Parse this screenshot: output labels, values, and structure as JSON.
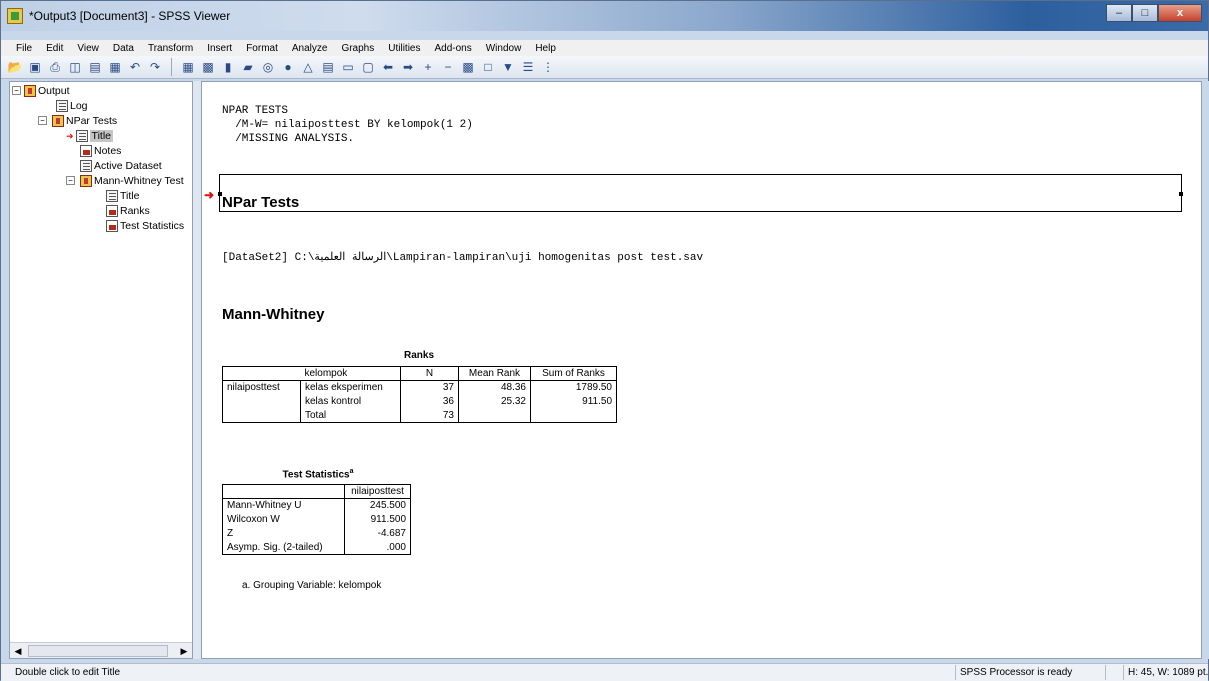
{
  "window": {
    "title": "*Output3 [Document3] - SPSS Viewer"
  },
  "menu": [
    "File",
    "Edit",
    "View",
    "Data",
    "Transform",
    "Insert",
    "Format",
    "Analyze",
    "Graphs",
    "Utilities",
    "Add-ons",
    "Window",
    "Help"
  ],
  "toolbar": {
    "icons": [
      "open-icon",
      "save-icon",
      "print-icon",
      "print-preview-icon",
      "export-icon",
      "dialog-recall-icon",
      "undo-icon",
      "redo-icon",
      "goto-data-icon",
      "goto-variable-icon",
      "variables-icon",
      "run-icon",
      "find-icon",
      "case-icon",
      "insert-output-icon",
      "insert-heading-icon",
      "insert-title-icon",
      "insert-text-icon",
      "back-icon",
      "forward-icon",
      "expand-icon",
      "collapse-icon",
      "show-icon",
      "hide-icon",
      "designate-window-icon",
      "select-last-output-icon",
      "pivot-icon"
    ]
  },
  "outline": {
    "nodes": [
      {
        "label": "Output"
      },
      {
        "label": "Log"
      },
      {
        "label": "NPar Tests"
      },
      {
        "label": "Title"
      },
      {
        "label": "Notes"
      },
      {
        "label": "Active Dataset"
      },
      {
        "label": "Mann-Whitney Test"
      },
      {
        "label": "Title"
      },
      {
        "label": "Ranks"
      },
      {
        "label": "Test Statistics"
      }
    ]
  },
  "content": {
    "syntax": "NPAR TESTS\n  /M-W= nilaiposttest BY kelompok(1 2)\n  /MISSING ANALYSIS.",
    "title_heading": "NPar Tests",
    "dataset_line": "[DataSet2] C:\\الرسالة العلمية\\Lampiran-lampiran\\uji homogenitas post test.sav",
    "section_heading": "Mann-Whitney",
    "ranks": {
      "title": "Ranks",
      "headers": [
        "kelompok",
        "N",
        "Mean Rank",
        "Sum of Ranks"
      ],
      "row_var": "nilaiposttest",
      "rows": [
        {
          "group": "kelas eksperimen",
          "n": "37",
          "mean_rank": "48.36",
          "sum_ranks": "1789.50"
        },
        {
          "group": "kelas kontrol",
          "n": "36",
          "mean_rank": "25.32",
          "sum_ranks": "911.50"
        },
        {
          "group": "Total",
          "n": "73",
          "mean_rank": "",
          "sum_ranks": ""
        }
      ]
    },
    "test_stats": {
      "title": "Test Statistics",
      "title_sup": "a",
      "header": "nilaiposttest",
      "rows": [
        {
          "label": "Mann-Whitney U",
          "value": "245.500"
        },
        {
          "label": "Wilcoxon W",
          "value": "911.500"
        },
        {
          "label": "Z",
          "value": "-4.687"
        },
        {
          "label": "Asymp. Sig. (2-tailed)",
          "value": ".000"
        }
      ],
      "footnote": "a. Grouping Variable: kelompok"
    }
  },
  "status": {
    "left": "Double click to edit Title",
    "processor": "SPSS  Processor is ready",
    "size": "H: 45, W: 1089 pt."
  },
  "colors": {
    "accent_red": "#e01010",
    "title_bar_blue": "#2d5f9e"
  }
}
